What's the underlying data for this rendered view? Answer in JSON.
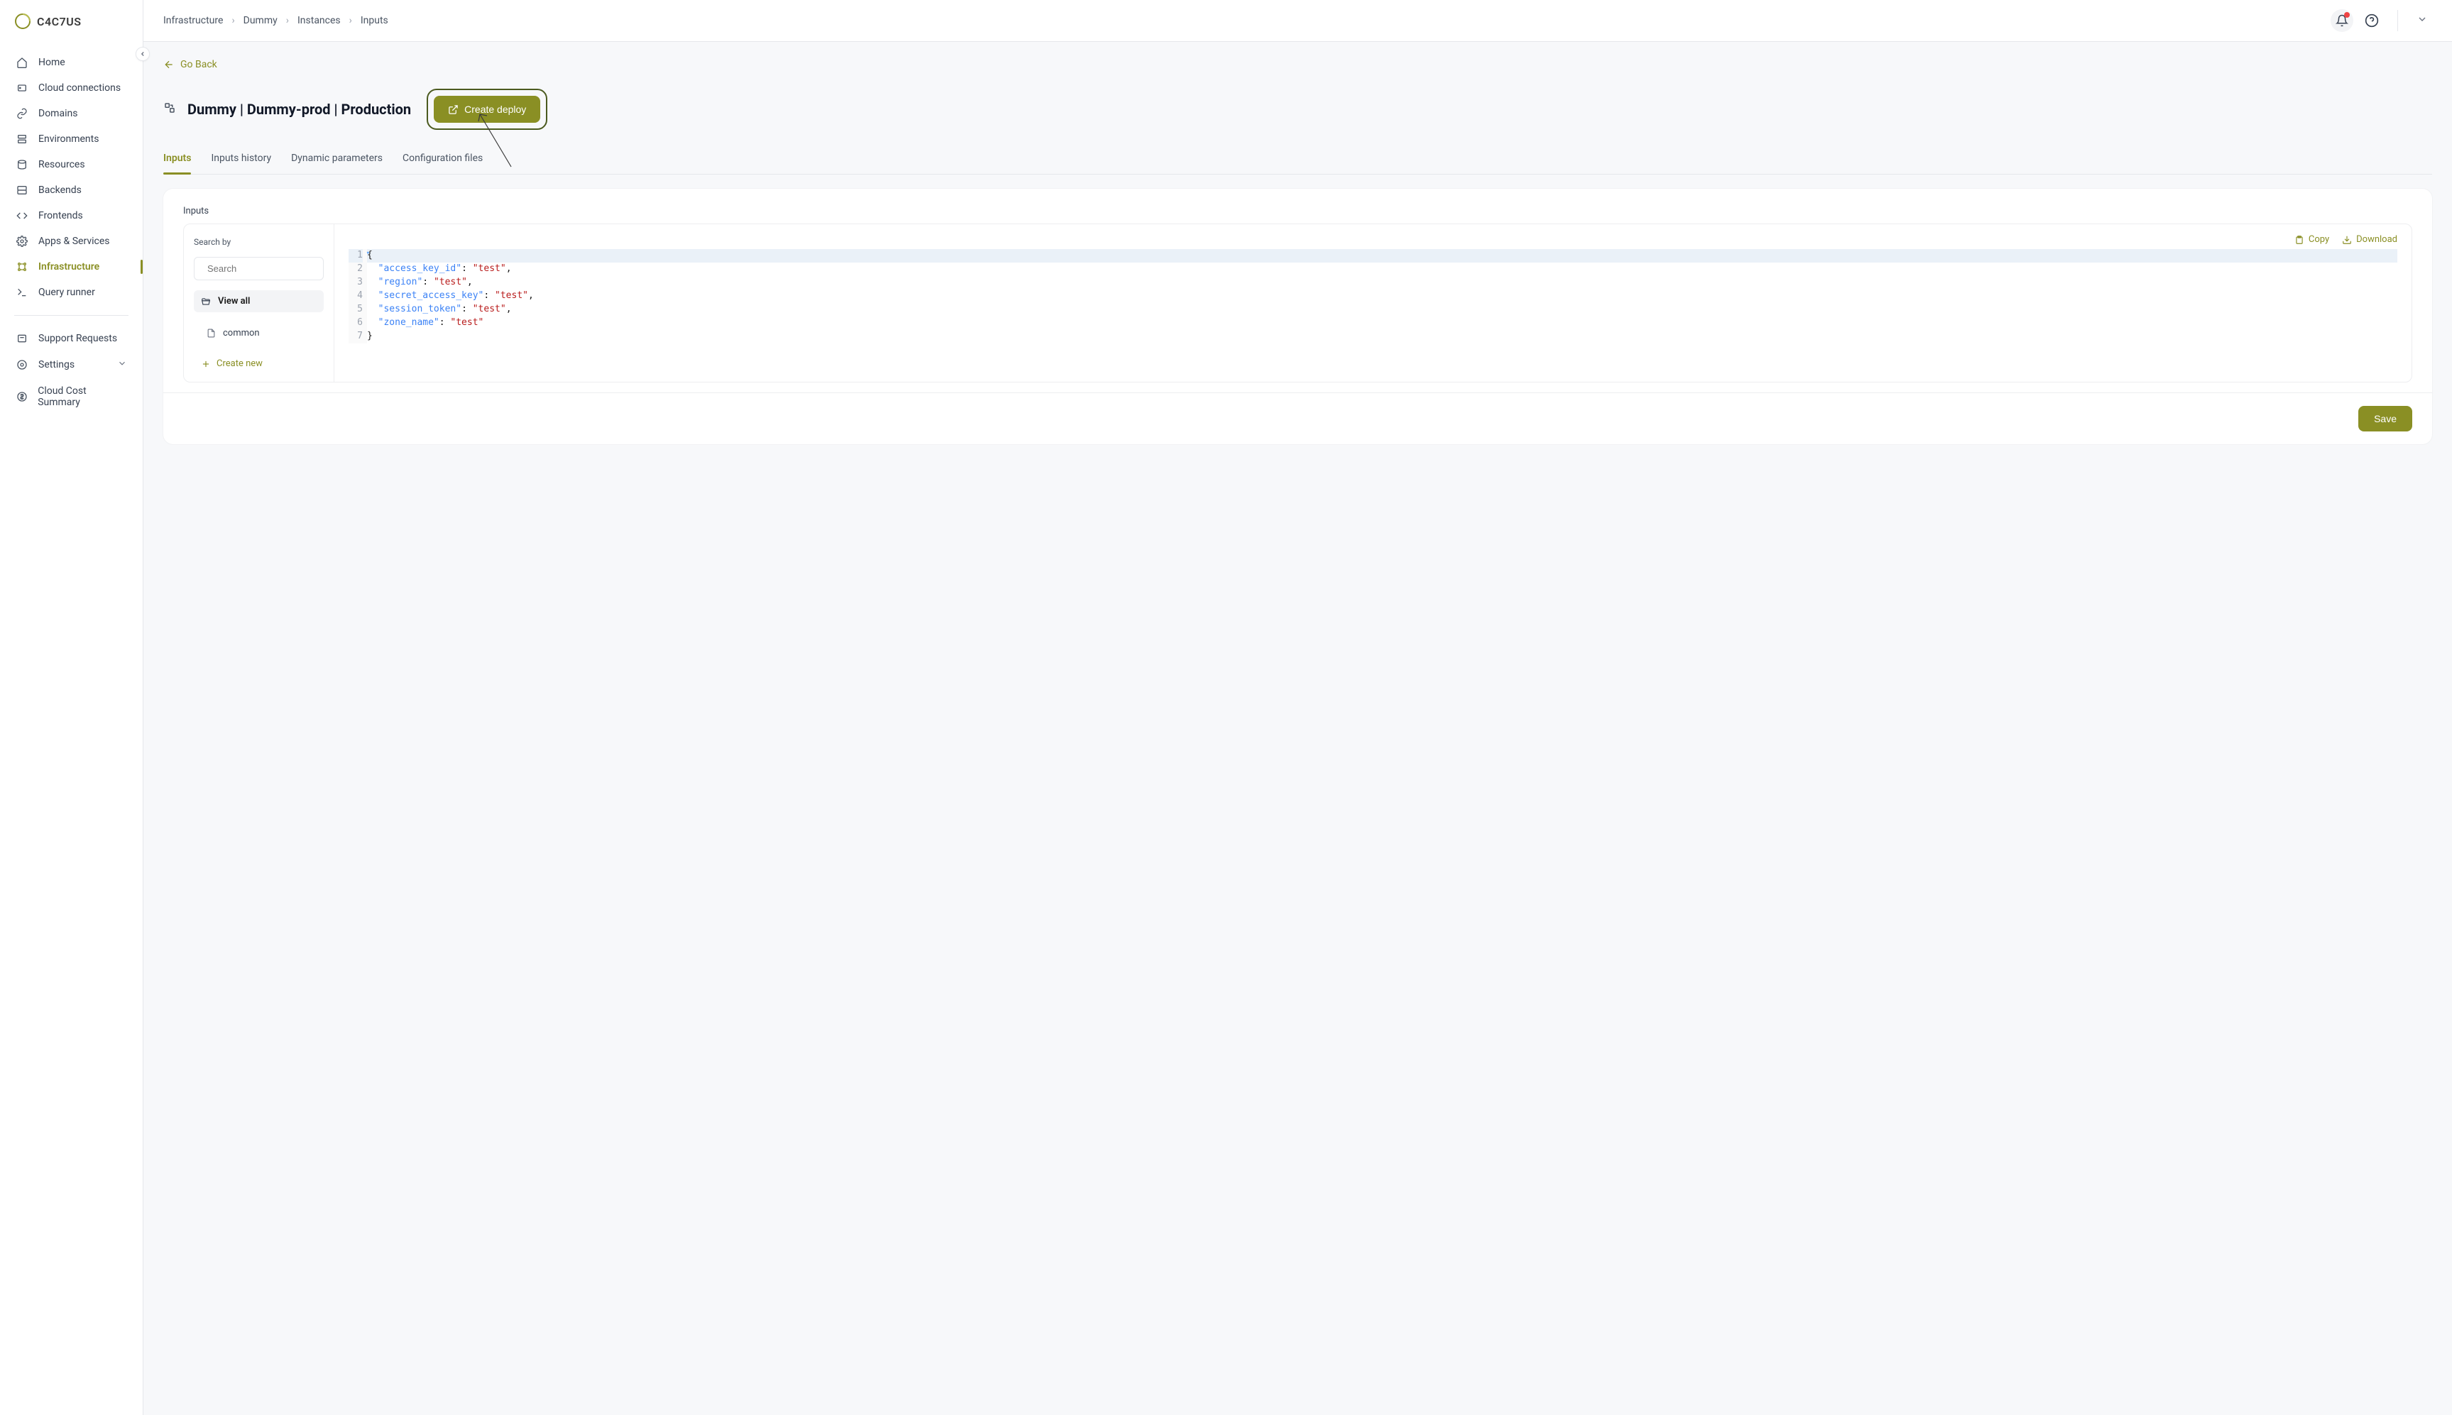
{
  "brand": "C4C7US",
  "sidebar": {
    "items": [
      {
        "label": "Home"
      },
      {
        "label": "Cloud connections"
      },
      {
        "label": "Domains"
      },
      {
        "label": "Environments"
      },
      {
        "label": "Resources"
      },
      {
        "label": "Backends"
      },
      {
        "label": "Frontends"
      },
      {
        "label": "Apps & Services"
      },
      {
        "label": "Infrastructure"
      },
      {
        "label": "Query runner"
      }
    ],
    "bottom": [
      {
        "label": "Support Requests"
      },
      {
        "label": "Settings"
      },
      {
        "label": "Cloud Cost Summary"
      }
    ]
  },
  "breadcrumb": [
    "Infrastructure",
    "Dummy",
    "Instances",
    "Inputs"
  ],
  "goback": "Go Back",
  "page_title": "Dummy | Dummy-prod | Production",
  "create_deploy": "Create deploy",
  "tabs": [
    "Inputs",
    "Inputs history",
    "Dynamic parameters",
    "Configuration files"
  ],
  "panel": {
    "title": "Inputs",
    "search_label": "Search by",
    "search_placeholder": "Search",
    "view_all": "View all",
    "file": "common",
    "create_new": "Create new",
    "copy": "Copy",
    "download": "Download",
    "save": "Save"
  },
  "code": {
    "line_numbers": [
      "1",
      "2",
      "3",
      "4",
      "5",
      "6",
      "7"
    ],
    "entries": [
      {
        "key": "access_key_id",
        "value": "test"
      },
      {
        "key": "region",
        "value": "test"
      },
      {
        "key": "secret_access_key",
        "value": "test"
      },
      {
        "key": "session_token",
        "value": "test"
      },
      {
        "key": "zone_name",
        "value": "test"
      }
    ]
  }
}
